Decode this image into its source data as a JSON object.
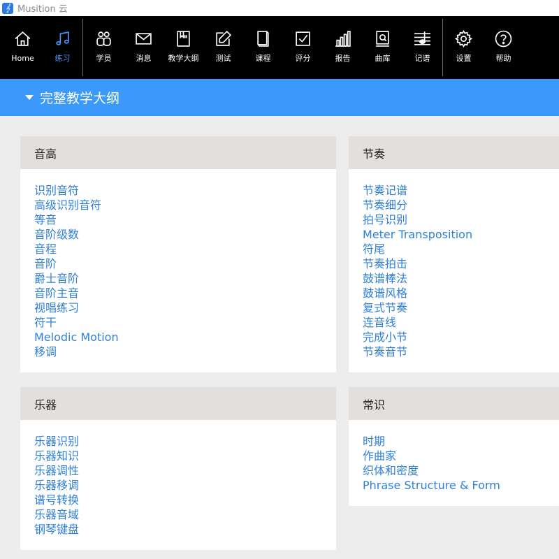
{
  "window": {
    "title": "Musition 云"
  },
  "toolbar": {
    "items": [
      {
        "label": "Home",
        "icon": "home-icon"
      },
      {
        "label": "练习",
        "icon": "music-note-icon",
        "active": true
      },
      {
        "label": "学员",
        "icon": "users-icon"
      },
      {
        "label": "消息",
        "icon": "envelope-icon"
      },
      {
        "label": "教学大纲",
        "icon": "syllabus-icon"
      },
      {
        "label": "测试",
        "icon": "edit-icon"
      },
      {
        "label": "课程",
        "icon": "book-icon"
      },
      {
        "label": "评分",
        "icon": "checkbox-icon"
      },
      {
        "label": "报告",
        "icon": "bar-chart-icon"
      },
      {
        "label": "曲库",
        "icon": "library-icon"
      },
      {
        "label": "记谱",
        "icon": "staff-icon"
      },
      {
        "label": "设置",
        "icon": "gear-icon"
      },
      {
        "label": "帮助",
        "icon": "help-icon"
      }
    ],
    "active_color": "#4a9bff"
  },
  "banner": {
    "title": "完整教学大纲",
    "color": "#3b99fc"
  },
  "sections": {
    "pitch": {
      "title": "音高",
      "items": [
        "识别音符",
        "高级识别音符",
        "等音",
        "音阶级数",
        "音程",
        "音阶",
        "爵士音阶",
        "音阶主音",
        "视唱练习",
        "符干",
        "Melodic Motion",
        "移调"
      ]
    },
    "rhythm": {
      "title": "节奏",
      "items": [
        "节奏记谱",
        "节奏细分",
        "拍号识别",
        "Meter Transposition",
        "符尾",
        "节奏拍击",
        "鼓谱棒法",
        "鼓谱风格",
        "复式节奏",
        "连音线",
        "完成小节",
        "节奏音节"
      ]
    },
    "instruments": {
      "title": "乐器",
      "items": [
        "乐器识别",
        "乐器知识",
        "乐器调性",
        "乐器移调",
        "谱号转换",
        "乐器音域",
        "钢琴键盘"
      ]
    },
    "general": {
      "title": "常识",
      "items": [
        "时期",
        "作曲家",
        "织体和密度",
        "Phrase Structure & Form"
      ]
    }
  }
}
